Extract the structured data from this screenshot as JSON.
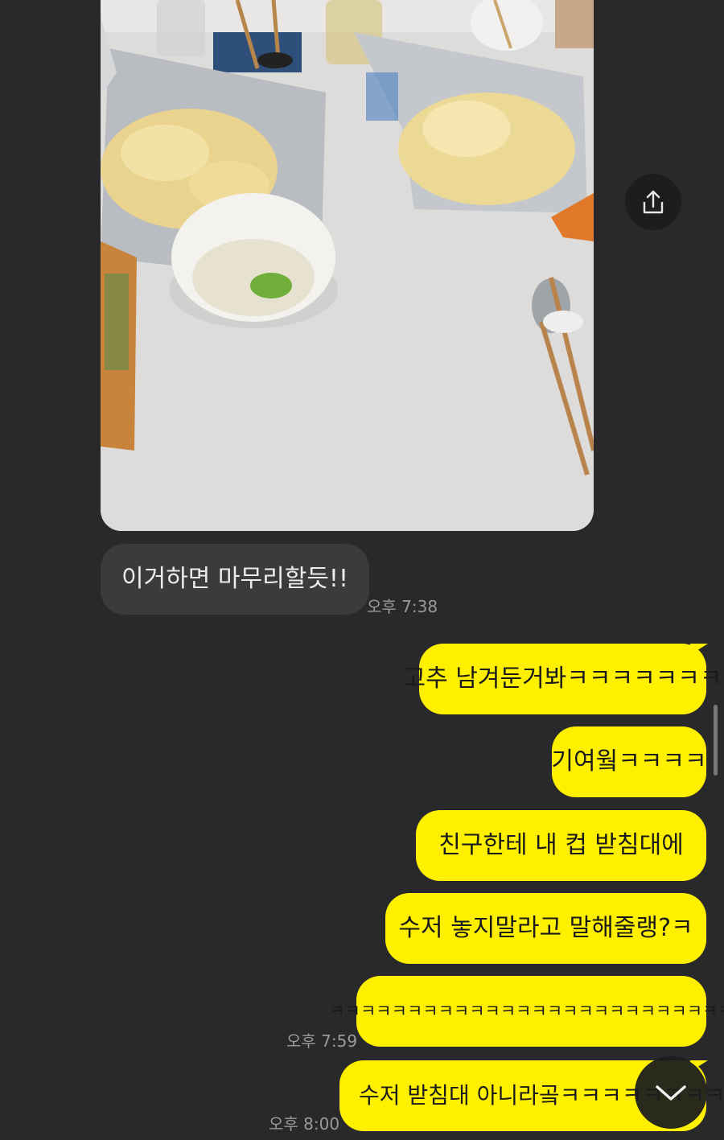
{
  "colors": {
    "background": "#29292b",
    "incoming_bubble": "#3b3b3d",
    "outgoing_bubble": "#fff000",
    "timestamp": "#9a9a9c"
  },
  "photo": {
    "icon": "share-icon"
  },
  "messages": {
    "incoming": {
      "text": "이거하면 마무리할듯!!",
      "time": "오후 7:38"
    },
    "outgoing": [
      {
        "text": "고추 남겨둔거봐ㅋㅋㅋㅋㅋㅋㅋ"
      },
      {
        "text": "기여웤ㅋㅋㅋㅋ"
      },
      {
        "text": "친구한테 내 컵 받침대에"
      },
      {
        "text": "수저 놓지말라고 말해줄랭?ㅋ"
      },
      {
        "text": "ㅋㅋㅋㅋㅋㅋㅋㅋㅋㅋㅋㅋㅋㅋㅋㅋㅋㅋㅋㅋㅋㅋㅋㅋㅋㅋ"
      },
      {
        "text": "수저 받침대 아니라곸ㅋㅋㅋㅋㅋㅋㅋㅋ"
      }
    ],
    "outgoing_times": [
      "오후 7:59",
      "오후 8:00"
    ]
  },
  "controls": {
    "scroll_down_icon": "chevron-down-icon"
  }
}
